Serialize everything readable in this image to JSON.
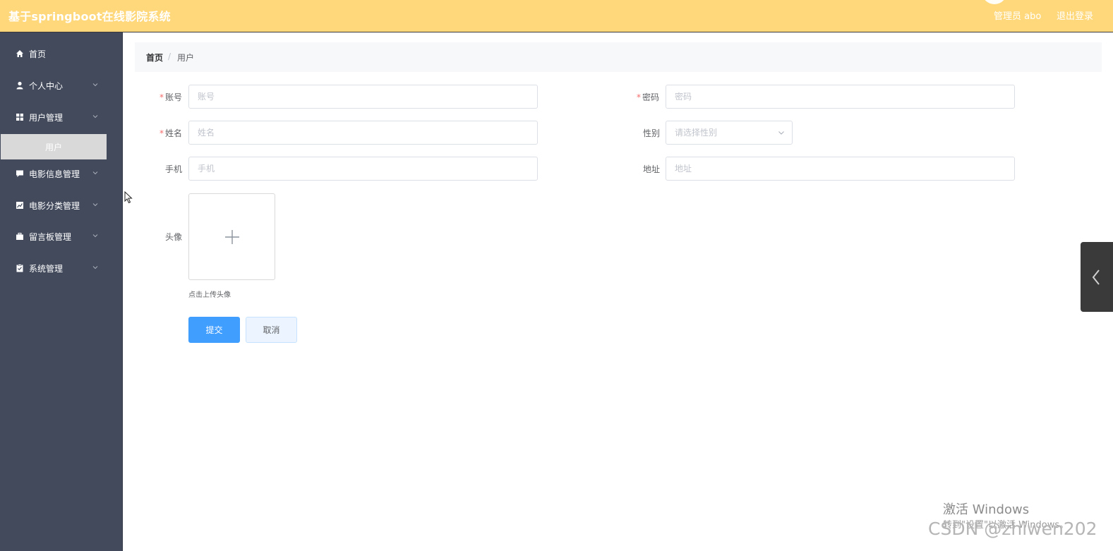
{
  "header": {
    "title": "基于springboot在线影院系统",
    "admin_label": "管理员 abo",
    "logout_label": "退出登录"
  },
  "sidebar": {
    "items": [
      {
        "label": "首页",
        "icon": "home-icon"
      },
      {
        "label": "个人中心",
        "icon": "user-icon"
      },
      {
        "label": "用户管理",
        "icon": "grid-icon"
      },
      {
        "label": "电影信息管理",
        "icon": "chat-icon"
      },
      {
        "label": "电影分类管理",
        "icon": "chart-icon"
      },
      {
        "label": "留言板管理",
        "icon": "briefcase-icon"
      },
      {
        "label": "系统管理",
        "icon": "clipboard-icon"
      }
    ],
    "active_subitem": "用户"
  },
  "breadcrumb": {
    "home": "首页",
    "separator": "/",
    "current": "用户"
  },
  "form": {
    "account": {
      "label": "账号",
      "placeholder": "账号",
      "required": true
    },
    "password": {
      "label": "密码",
      "placeholder": "密码",
      "required": true
    },
    "name": {
      "label": "姓名",
      "placeholder": "姓名",
      "required": true
    },
    "gender": {
      "label": "性别",
      "placeholder": "请选择性别"
    },
    "phone": {
      "label": "手机",
      "placeholder": "手机"
    },
    "address": {
      "label": "地址",
      "placeholder": "地址"
    },
    "avatar": {
      "label": "头像",
      "hint": "点击上传头像"
    },
    "required_mark": "*",
    "submit_label": "提交",
    "cancel_label": "取消"
  },
  "overlay": {
    "activate_title": "激活 Windows",
    "activate_subtitle": "转到\"设置\"以激活 Windows。",
    "csdn": "CSDN @zhiwen202"
  },
  "colors": {
    "header_bg": "#fed87b",
    "sidebar_bg": "#424a5c",
    "primary": "#409eff",
    "required": "#f56c6c"
  }
}
